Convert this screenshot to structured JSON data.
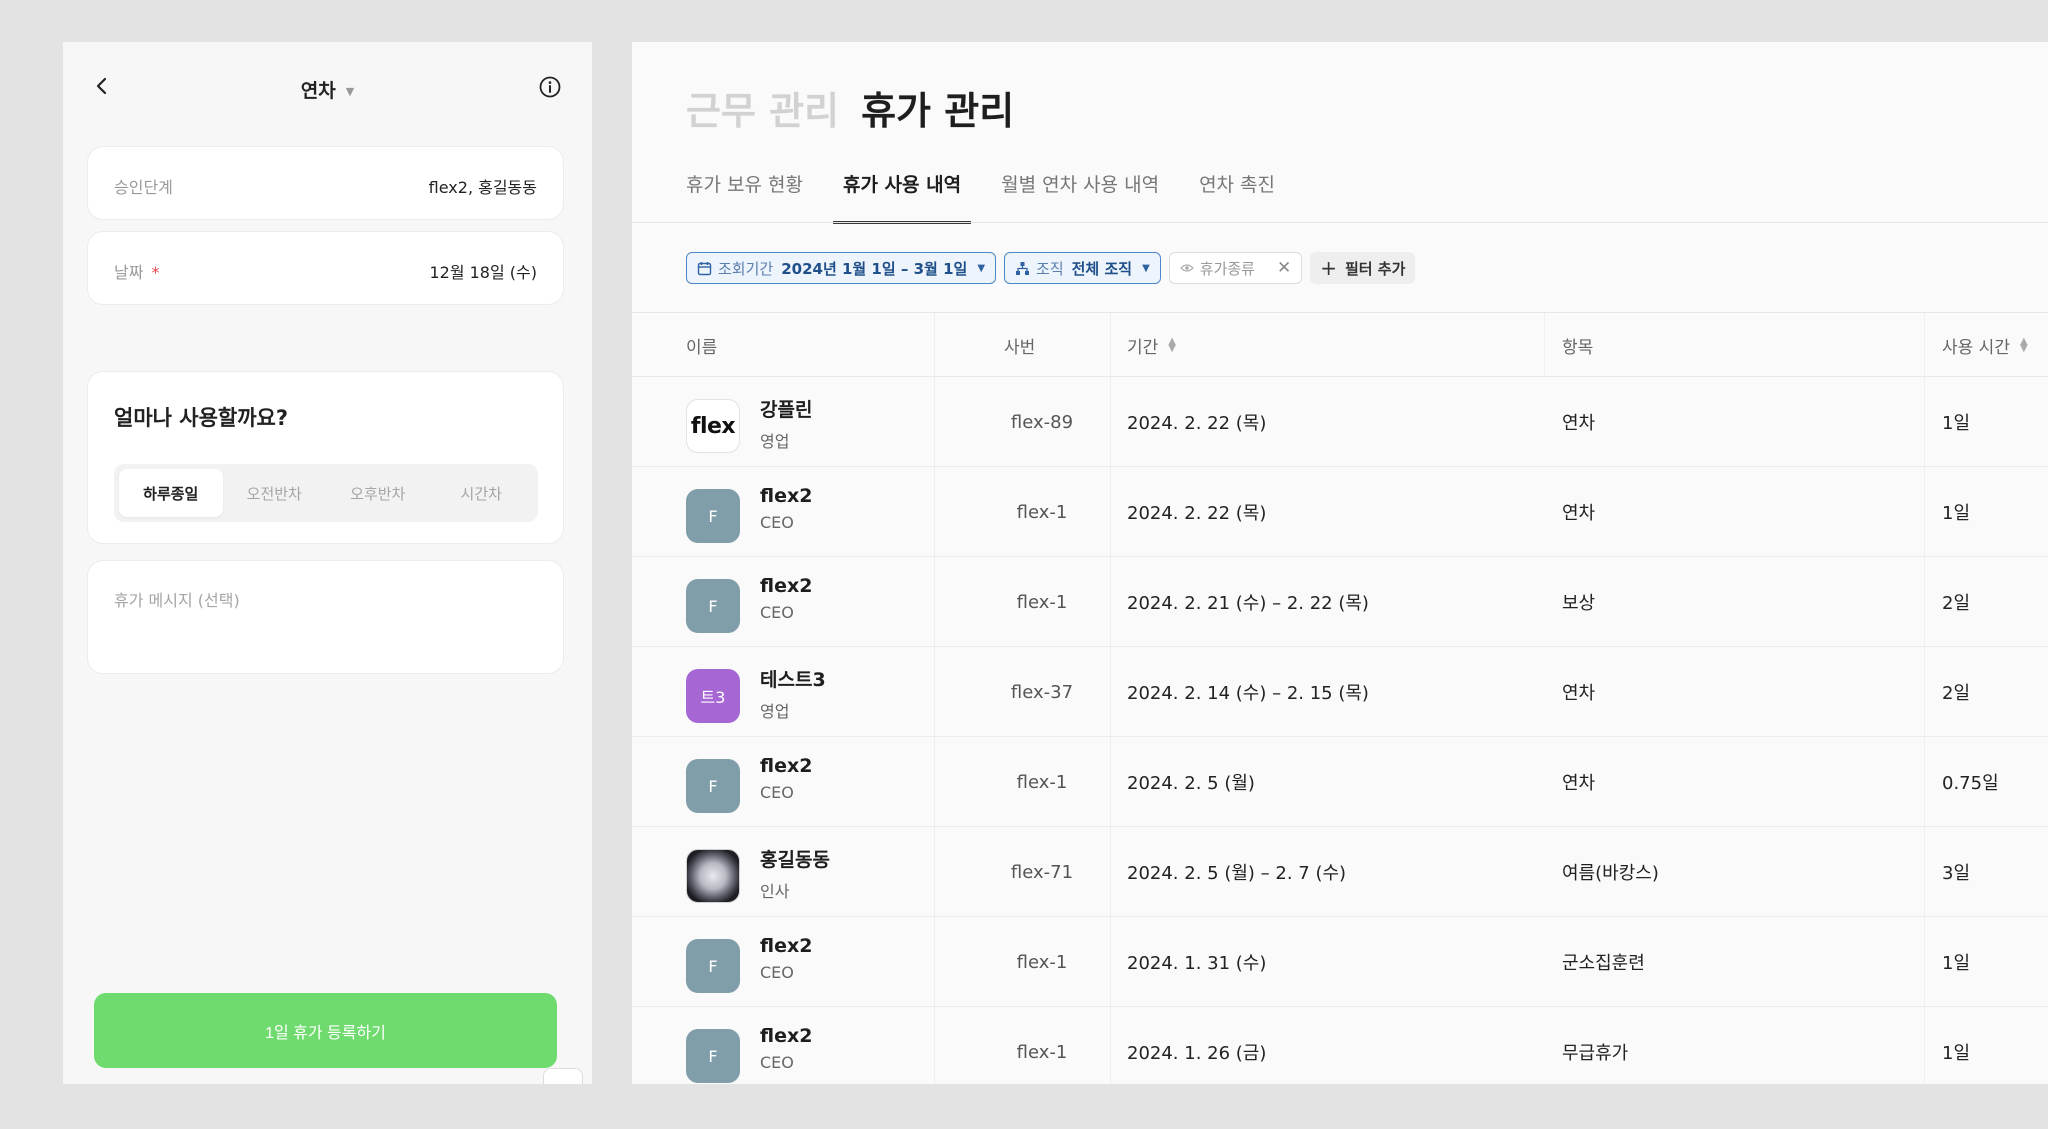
{
  "mobile": {
    "title": "연차",
    "approval_label": "승인단계",
    "approval_value": "flex2, 홍길동동",
    "date_label": "날짜",
    "date_required": "*",
    "date_value": "12월 18일 (수)",
    "amount_question": "얼마나 사용할까요?",
    "segments": [
      "하루종일",
      "오전반차",
      "오후반차",
      "시간차"
    ],
    "selected_segment": "하루종일",
    "message_placeholder": "휴가 메시지 (선택)",
    "submit_label": "1일 휴가 등록하기",
    "colors": {
      "submit": "#6fdb6f"
    }
  },
  "desktop": {
    "title_inactive": "근무 관리",
    "title_active": "휴가 관리",
    "tabs": [
      "휴가 보유 현황",
      "휴가 사용 내역",
      "월별 연차 사용 내역",
      "연차 촉진"
    ],
    "active_tab": "휴가 사용 내역",
    "filters": {
      "period_label": "조회기간",
      "period_value": "2024년 1월 1일 – 3월 1일",
      "org_label": "조직",
      "org_value": "전체 조직",
      "leave_type": "휴가종류",
      "add_filter": "필터 추가"
    },
    "columns": [
      "이름",
      "사번",
      "기간",
      "항목",
      "사용 시간"
    ],
    "rows": [
      {
        "avatar": "flex",
        "avatar_type": "logo",
        "name": "강플린",
        "dept": "영업",
        "emp_no": "flex-89",
        "period": "2024. 2. 22 (목)",
        "item": "연차",
        "time": "1일"
      },
      {
        "avatar": "F",
        "avatar_type": "initial",
        "name": "flex2",
        "dept": "CEO",
        "emp_no": "flex-1",
        "period": "2024. 2. 22 (목)",
        "item": "연차",
        "time": "1일"
      },
      {
        "avatar": "F",
        "avatar_type": "initial",
        "name": "flex2",
        "dept": "CEO",
        "emp_no": "flex-1",
        "period": "2024. 2. 21 (수) – 2. 22 (목)",
        "item": "보상",
        "time": "2일"
      },
      {
        "avatar": "트3",
        "avatar_type": "initial-purple",
        "name": "테스트3",
        "dept": "영업",
        "emp_no": "flex-37",
        "period": "2024. 2. 14 (수) – 2. 15 (목)",
        "item": "연차",
        "time": "2일"
      },
      {
        "avatar": "F",
        "avatar_type": "initial",
        "name": "flex2",
        "dept": "CEO",
        "emp_no": "flex-1",
        "period": "2024. 2. 5 (월)",
        "item": "연차",
        "time": "0.75일"
      },
      {
        "avatar": "",
        "avatar_type": "photo-moon",
        "name": "홍길동동",
        "dept": "인사",
        "emp_no": "flex-71",
        "period": "2024. 2. 5 (월) – 2. 7 (수)",
        "item": "여름(바캉스)",
        "time": "3일"
      },
      {
        "avatar": "F",
        "avatar_type": "initial",
        "name": "flex2",
        "dept": "CEO",
        "emp_no": "flex-1",
        "period": "2024. 1. 31 (수)",
        "item": "군소집훈련",
        "time": "1일"
      },
      {
        "avatar": "F",
        "avatar_type": "initial",
        "name": "flex2",
        "dept": "CEO",
        "emp_no": "flex-1",
        "period": "2024. 1. 26 (금)",
        "item": "무급휴가",
        "time": "1일"
      }
    ]
  }
}
